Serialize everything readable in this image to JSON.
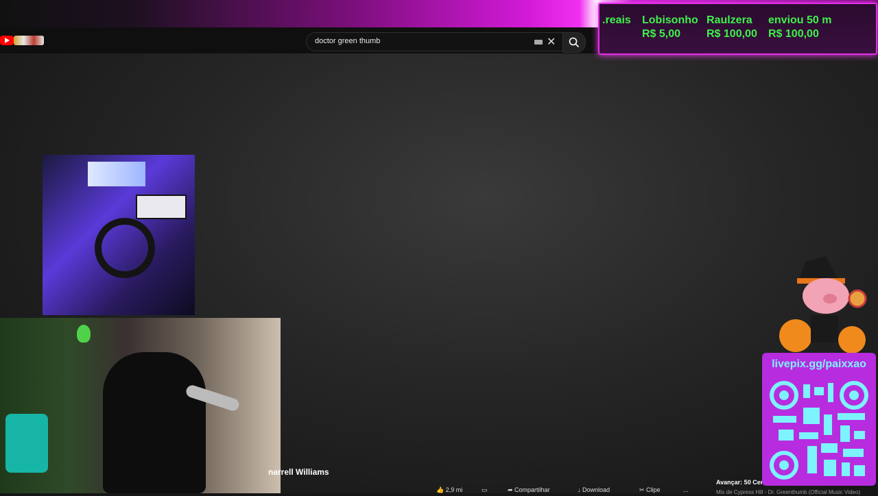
{
  "app": {
    "name": "YouTube"
  },
  "search": {
    "query": "doctor green thumb"
  },
  "donations": [
    {
      "name": ".reais",
      "amount": ""
    },
    {
      "name": "Lobisonho",
      "amount": "R$ 5,00"
    },
    {
      "name": "Raulzera",
      "amount": "R$ 100,00"
    },
    {
      "name": "enviou 50 m",
      "amount": "R$ 100,00"
    }
  ],
  "caption": "narrell Williams",
  "actions": {
    "likes": "2,9 mi",
    "share": "Compartilhar",
    "download": "Download",
    "clip": "Clipe",
    "more": "..."
  },
  "up_next": {
    "label": "Avançar: 50 Cen",
    "title": "Mix de Cypress Hill - Dr. Greenthumb (Official Music Video)"
  },
  "livepix": {
    "url": "livepix.gg/paixxao"
  },
  "colors": {
    "accent": "#e12ee6",
    "donation_text": "#3ef24a",
    "qr": "#7df3ff"
  }
}
